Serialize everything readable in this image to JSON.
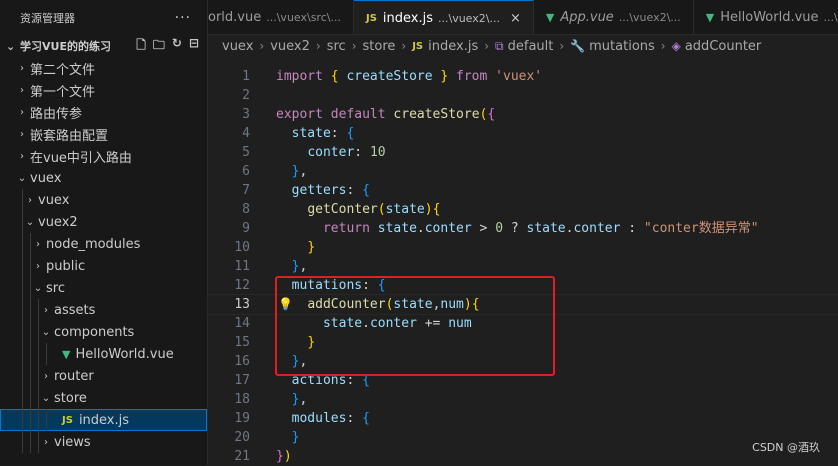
{
  "sidebar": {
    "title": "资源管理器",
    "more": "···",
    "root": "学习VUE的的练习",
    "items": [
      {
        "label": "第二个文件",
        "chev": "›",
        "indent": 0
      },
      {
        "label": "第一个文件",
        "chev": "›",
        "indent": 0
      },
      {
        "label": "路由传参",
        "chev": "›",
        "indent": 0
      },
      {
        "label": "嵌套路由配置",
        "chev": "›",
        "indent": 0
      },
      {
        "label": "在vue中引入路由",
        "chev": "›",
        "indent": 0
      },
      {
        "label": "vuex",
        "chev": "⌄",
        "indent": 0
      },
      {
        "label": "vuex",
        "chev": "›",
        "indent": 1
      },
      {
        "label": "vuex2",
        "chev": "⌄",
        "indent": 1
      },
      {
        "label": "node_modules",
        "chev": "›",
        "indent": 2
      },
      {
        "label": "public",
        "chev": "›",
        "indent": 2
      },
      {
        "label": "src",
        "chev": "⌄",
        "indent": 2
      },
      {
        "label": "assets",
        "chev": "›",
        "indent": 3
      },
      {
        "label": "components",
        "chev": "⌄",
        "indent": 3
      },
      {
        "label": "HelloWorld.vue",
        "chev": "",
        "indent": 4,
        "badge": "vue"
      },
      {
        "label": "router",
        "chev": "›",
        "indent": 3
      },
      {
        "label": "store",
        "chev": "⌄",
        "indent": 3
      },
      {
        "label": "index.js",
        "chev": "",
        "indent": 4,
        "badge": "JS",
        "selected": true
      },
      {
        "label": "views",
        "chev": "›",
        "indent": 3
      }
    ]
  },
  "tabs": [
    {
      "label": "orld.vue",
      "desc": "...\\vuex\\src\\...",
      "icon": "",
      "active": false
    },
    {
      "label": "index.js",
      "desc": "...\\vuex2\\...",
      "icon": "JS",
      "active": true,
      "close": "×"
    },
    {
      "label": "App.vue",
      "desc": "...\\vuex2\\...",
      "icon": "vue",
      "active": false,
      "italic": true
    },
    {
      "label": "HelloWorld.vue",
      "desc": "...\\vuex\\...",
      "icon": "vue",
      "active": false
    }
  ],
  "breadcrumb": [
    "vuex",
    "vuex2",
    "src",
    "store",
    "index.js",
    "default",
    "mutations",
    "addCounter"
  ],
  "editor": {
    "current_line": 13,
    "lines": [
      [
        [
          "kw",
          "import"
        ],
        [
          "p",
          " "
        ],
        [
          "b1",
          "{"
        ],
        [
          "p",
          " "
        ],
        [
          "v",
          "createStore"
        ],
        [
          "p",
          " "
        ],
        [
          "b1",
          "}"
        ],
        [
          "p",
          " "
        ],
        [
          "kw",
          "from"
        ],
        [
          "p",
          " "
        ],
        [
          "s",
          "'vuex'"
        ]
      ],
      [],
      [
        [
          "kw",
          "export"
        ],
        [
          "p",
          " "
        ],
        [
          "kw",
          "default"
        ],
        [
          "p",
          " "
        ],
        [
          "fn",
          "createStore"
        ],
        [
          "b1",
          "("
        ],
        [
          "b2",
          "{"
        ]
      ],
      [
        [
          "p",
          "  "
        ],
        [
          "v",
          "state"
        ],
        [
          "p",
          ": "
        ],
        [
          "b3",
          "{"
        ]
      ],
      [
        [
          "p",
          "    "
        ],
        [
          "v",
          "conter"
        ],
        [
          "p",
          ": "
        ],
        [
          "n",
          "10"
        ]
      ],
      [
        [
          "p",
          "  "
        ],
        [
          "b3",
          "}"
        ],
        [
          "p",
          ","
        ]
      ],
      [
        [
          "p",
          "  "
        ],
        [
          "v",
          "getters"
        ],
        [
          "p",
          ": "
        ],
        [
          "b3",
          "{"
        ]
      ],
      [
        [
          "p",
          "    "
        ],
        [
          "fn",
          "getConter"
        ],
        [
          "b1",
          "("
        ],
        [
          "v",
          "state"
        ],
        [
          "b1",
          ")"
        ],
        [
          "b1",
          "{"
        ]
      ],
      [
        [
          "p",
          "      "
        ],
        [
          "kw",
          "return"
        ],
        [
          "p",
          " "
        ],
        [
          "v",
          "state"
        ],
        [
          "p",
          "."
        ],
        [
          "v",
          "conter"
        ],
        [
          "p",
          " > "
        ],
        [
          "n",
          "0"
        ],
        [
          "p",
          " ? "
        ],
        [
          "v",
          "state"
        ],
        [
          "p",
          "."
        ],
        [
          "v",
          "conter"
        ],
        [
          "p",
          " : "
        ],
        [
          "s",
          "\"conter数据异常\""
        ]
      ],
      [
        [
          "p",
          "    "
        ],
        [
          "b1",
          "}"
        ]
      ],
      [
        [
          "p",
          "  "
        ],
        [
          "b3",
          "}"
        ],
        [
          "p",
          ","
        ]
      ],
      [
        [
          "p",
          "  "
        ],
        [
          "v",
          "mutations"
        ],
        [
          "p",
          ": "
        ],
        [
          "b3",
          "{"
        ]
      ],
      [
        [
          "p",
          "    "
        ],
        [
          "fn",
          "addCounter"
        ],
        [
          "b1",
          "("
        ],
        [
          "v",
          "state"
        ],
        [
          "p",
          ","
        ],
        [
          "v",
          "num"
        ],
        [
          "b1",
          ")"
        ],
        [
          "b1",
          "{"
        ]
      ],
      [
        [
          "p",
          "      "
        ],
        [
          "v",
          "state"
        ],
        [
          "p",
          "."
        ],
        [
          "v",
          "conter"
        ],
        [
          "p",
          " += "
        ],
        [
          "v",
          "num"
        ]
      ],
      [
        [
          "p",
          "    "
        ],
        [
          "b1",
          "}"
        ]
      ],
      [
        [
          "p",
          "  "
        ],
        [
          "b3",
          "}"
        ],
        [
          "p",
          ","
        ]
      ],
      [
        [
          "p",
          "  "
        ],
        [
          "v",
          "actions"
        ],
        [
          "p",
          ": "
        ],
        [
          "b3",
          "{"
        ]
      ],
      [
        [
          "p",
          "  "
        ],
        [
          "b3",
          "}"
        ],
        [
          "p",
          ","
        ]
      ],
      [
        [
          "p",
          "  "
        ],
        [
          "v",
          "modules"
        ],
        [
          "p",
          ": "
        ],
        [
          "b3",
          "{"
        ]
      ],
      [
        [
          "p",
          "  "
        ],
        [
          "b3",
          "}"
        ]
      ],
      [
        [
          "b2",
          "}"
        ],
        [
          "b1",
          ")"
        ]
      ]
    ]
  },
  "watermark": "CSDN @酒玖"
}
